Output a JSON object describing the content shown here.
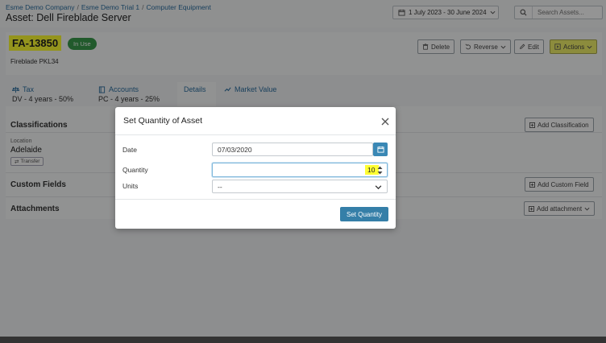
{
  "header": {
    "breadcrumbs": [
      "Esme Demo Company",
      "Esme Demo Trial 1",
      "Computer Equipment"
    ],
    "title": "Asset: Dell Fireblade Server",
    "date_range": "1 July 2023 - 30 June 2024",
    "search_placeholder": "Search Assets..."
  },
  "asset": {
    "code": "FA-13850",
    "status": "In Use",
    "subtitle": "Fireblade PKL34",
    "status_color": "#3a9b4d",
    "highlight_color": "#ffff33"
  },
  "toolbar": {
    "delete": "Delete",
    "reverse": "Reverse",
    "edit": "Edit",
    "actions": "Actions"
  },
  "tabs": [
    {
      "label": "Tax",
      "sub": "DV - 4 years - 50%",
      "icon": "scale-icon"
    },
    {
      "label": "Accounts",
      "sub": "PC - 4 years - 25%",
      "icon": "book-icon"
    },
    {
      "label": "Details",
      "sub": ""
    },
    {
      "label": "Market Value",
      "sub": "",
      "icon": "trend-icon"
    }
  ],
  "sections": {
    "classifications": "Classifications",
    "add_classification": "Add Classification",
    "location_label": "Location",
    "location_value": "Adelaide",
    "transfer": "Transfer",
    "custom_fields": "Custom Fields",
    "add_custom_field": "Add Custom Field",
    "attachments": "Attachments",
    "add_attachment": "Add attachment"
  },
  "modal": {
    "title": "Set Quantity of Asset",
    "date_label": "Date",
    "date_value": "07/03/2020",
    "quantity_label": "Quantity",
    "quantity_value": "10",
    "units_label": "Units",
    "units_value": "--",
    "submit": "Set Quantity",
    "accent_color": "#357fa8"
  }
}
